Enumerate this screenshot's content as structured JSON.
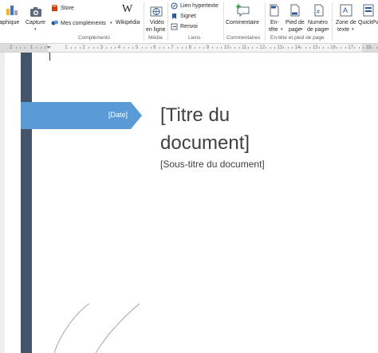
{
  "ribbon": {
    "chart_label": "raphique",
    "capture_label": "Capture",
    "store_label": "Store",
    "addins_label": "Mes compléments",
    "wikipedia_label": "Wikipédia",
    "complements_group": "Compléments",
    "video_label_1": "Vidéo",
    "video_label_2": "en ligne",
    "media_group": "Média",
    "hyperlink_label": "Lien hypertexte",
    "bookmark_label": "Signet",
    "crossref_label": "Renvoi",
    "links_group": "Liens",
    "comment_label": "Commentaire",
    "comments_group": "Commentaires",
    "header_label_1": "En-",
    "header_label_2": "tête",
    "footer_label_1": "Pied de",
    "footer_label_2": "page",
    "pagenum_label_1": "Numéro",
    "pagenum_label_2": "de page",
    "headerfooter_group": "En-tête et pied de page",
    "textbox_label_1": "Zone de",
    "textbox_label_2": "texte",
    "quickparts_label": "QuickPa"
  },
  "ruler": {
    "labels": [
      "2",
      "1",
      "1",
      "2",
      "3",
      "4",
      "5",
      "6",
      "7",
      "8",
      "9",
      "10",
      "11",
      "12",
      "13",
      "14",
      "15",
      "16",
      "17",
      "18"
    ]
  },
  "document": {
    "date_placeholder": "[Date]",
    "title_line1": "[Titre du",
    "title_line2": "document]",
    "subtitle": "[Sous-titre du document]"
  },
  "colors": {
    "sidebar": "#44546a",
    "date_banner": "#5b9bd5",
    "title_text": "#404040"
  }
}
